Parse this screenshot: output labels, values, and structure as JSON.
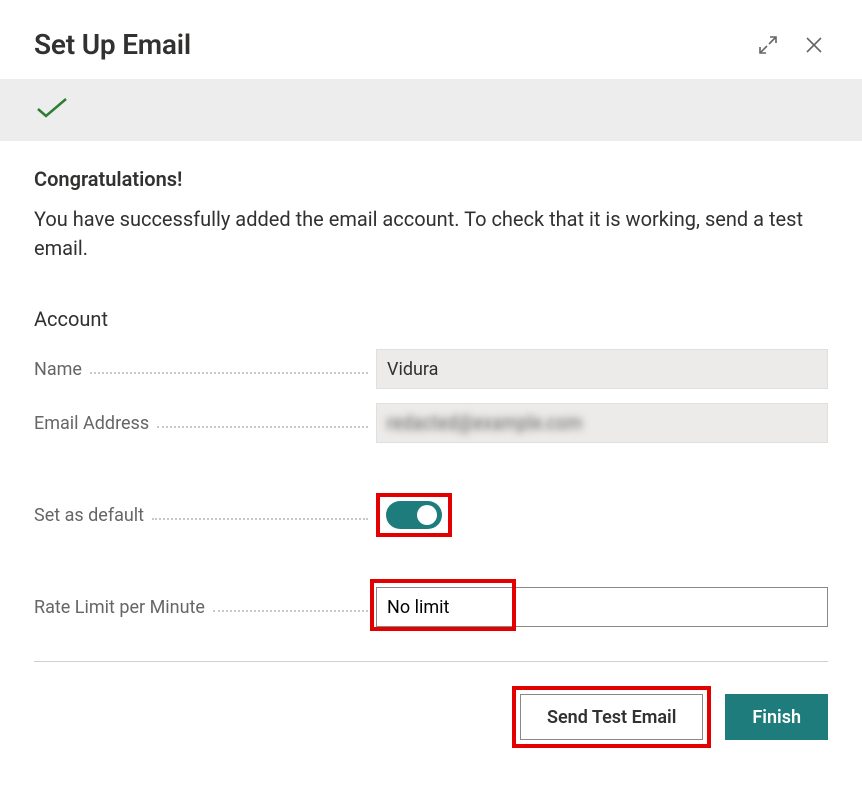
{
  "title": "Set Up Email",
  "status": {
    "icon": "check"
  },
  "congrats": {
    "heading": "Congratulations!",
    "body": "You have successfully added the email account. To check that it is working, send a test email."
  },
  "account": {
    "heading": "Account",
    "name_label": "Name",
    "name_value": "Vidura",
    "email_label": "Email Address",
    "email_value": "redacted@example.com",
    "default_label": "Set as default",
    "default_on": true,
    "rate_limit_label": "Rate Limit per Minute",
    "rate_limit_value": "No limit"
  },
  "footer": {
    "send_test_label": "Send Test Email",
    "finish_label": "Finish"
  },
  "colors": {
    "accent": "#1f7c7c",
    "highlight": "#e30000",
    "check": "#2e7d32"
  }
}
